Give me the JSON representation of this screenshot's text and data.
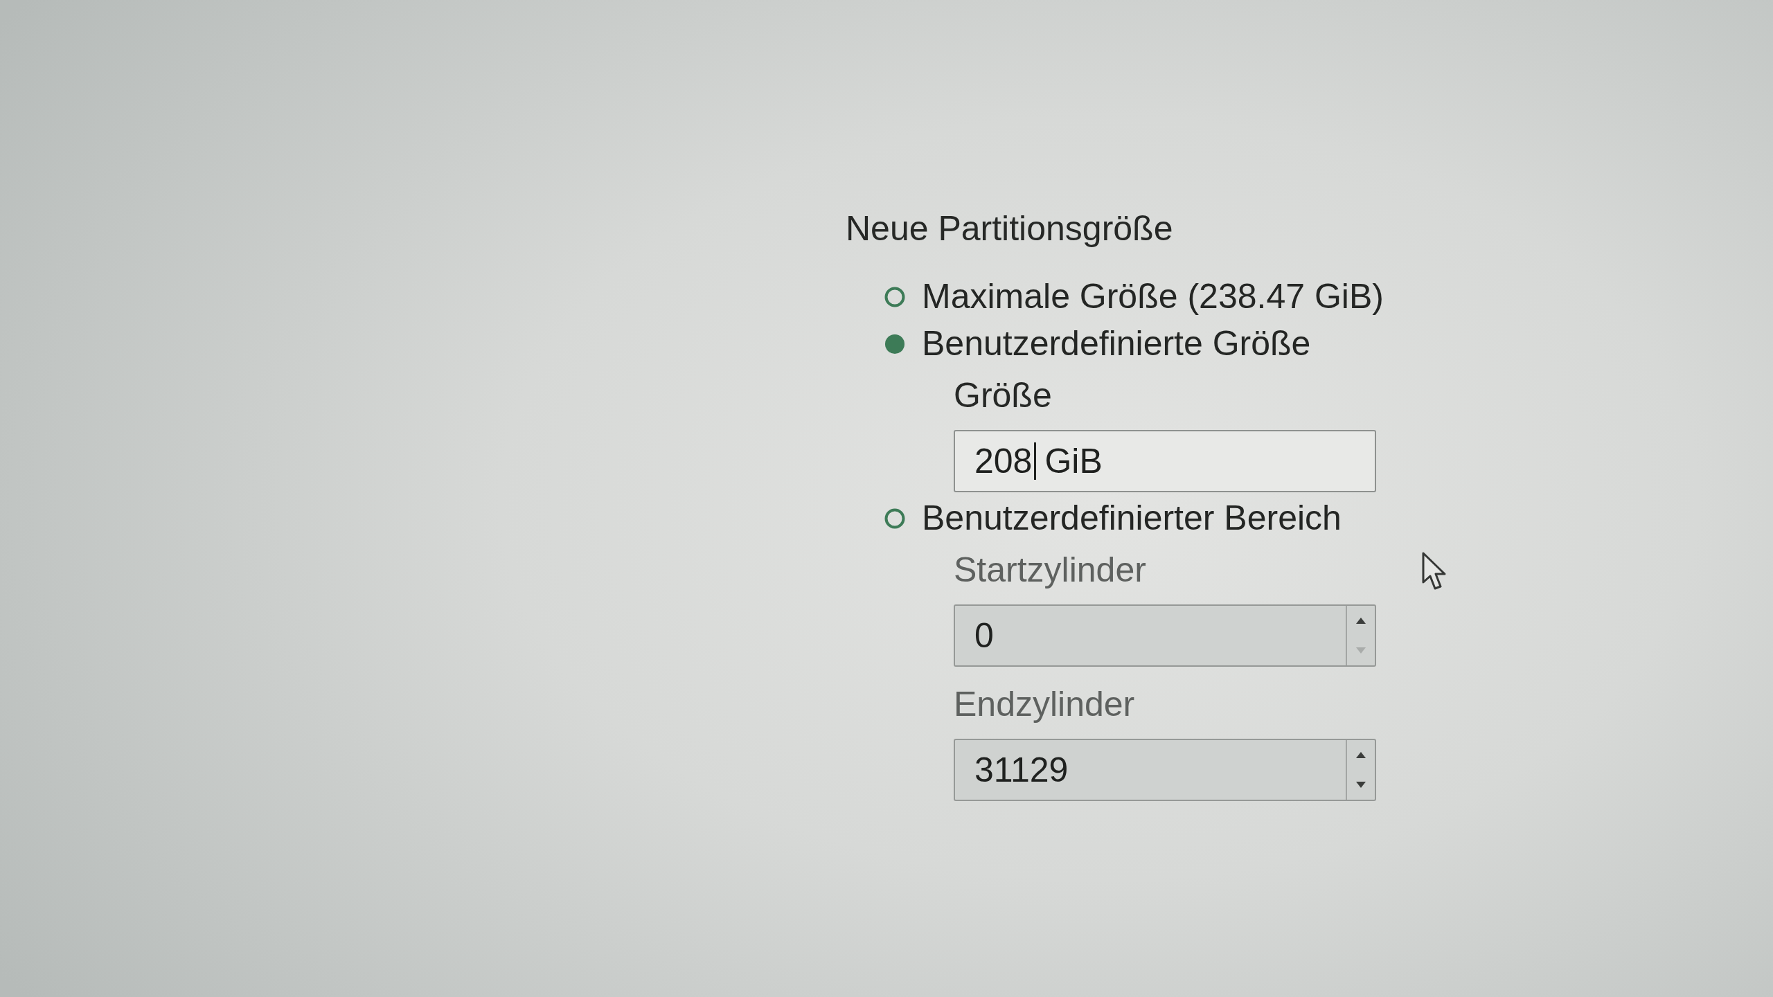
{
  "heading": "Neue Partitionsgröße",
  "options": [
    {
      "label": "Maximale Größe (238.47 GiB)",
      "selected": false
    },
    {
      "label": "Benutzerdefinierte Größe",
      "selected": true,
      "fields": [
        {
          "kind": "text",
          "label": "Größe",
          "value_before_caret": "208",
          "value_after_caret": "GiB",
          "disabled": false
        }
      ]
    },
    {
      "label": "Benutzerdefinierter Bereich",
      "selected": false,
      "fields": [
        {
          "kind": "spin",
          "label": "Startzylinder",
          "value": "0",
          "disabled": true,
          "up_enabled": true,
          "down_enabled": false
        },
        {
          "kind": "spin",
          "label": "Endzylinder",
          "value": "31129",
          "disabled": true,
          "up_enabled": true,
          "down_enabled": true
        }
      ]
    }
  ]
}
